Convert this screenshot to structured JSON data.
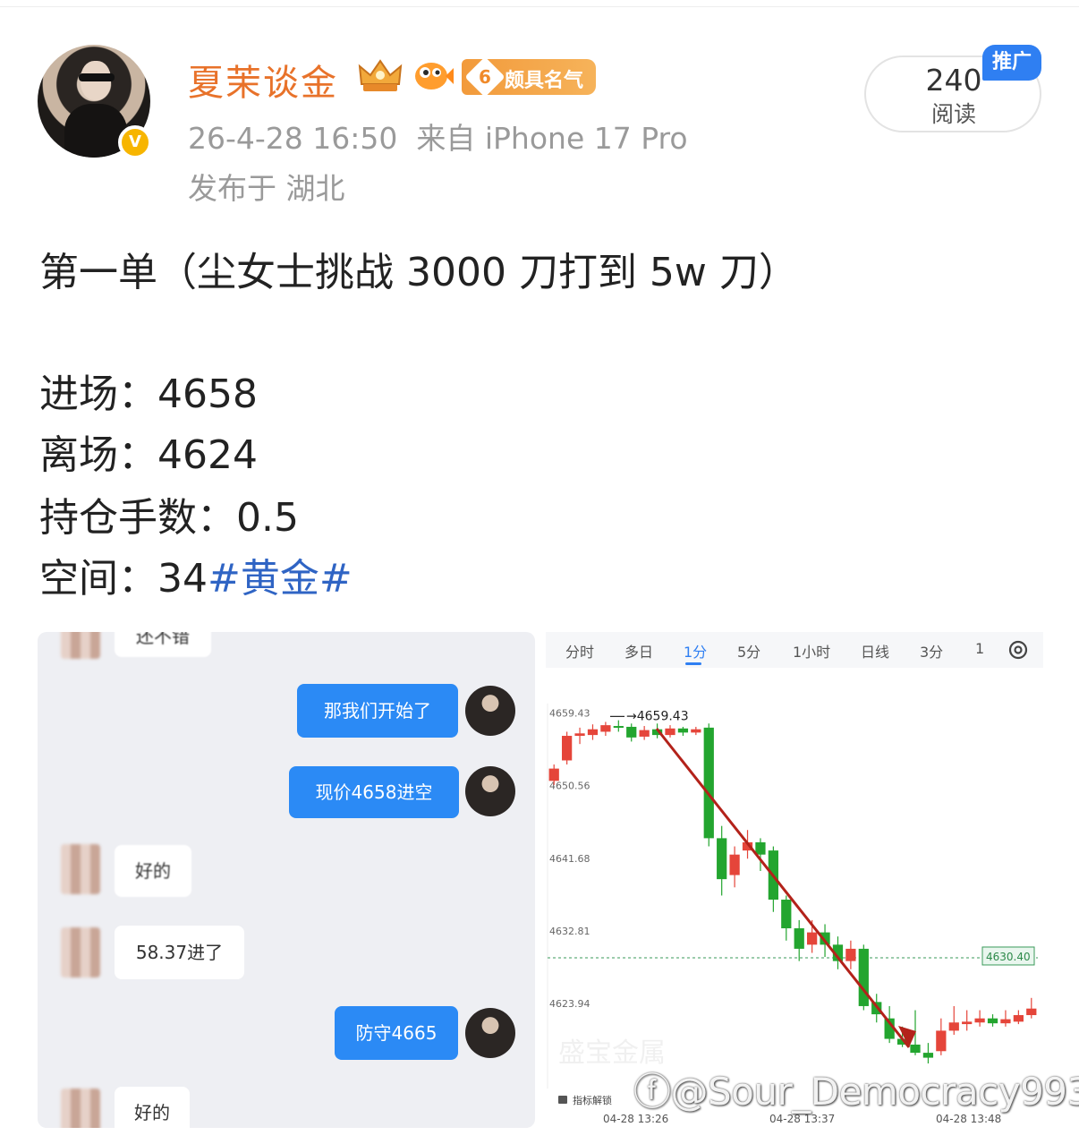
{
  "post": {
    "author": {
      "name": "夏茉谈金",
      "badge_level": "6",
      "badge_label": "颇具名气",
      "verified_mark": "V"
    },
    "meta": "26-4-28 16:50  来自 iPhone 17 Pro",
    "location": "发布于 湖北",
    "reads": {
      "count": "240",
      "label": "阅读"
    },
    "promo_tag": "推广",
    "lines": {
      "title": "第一单（尘女士挑战 3000 刀打到 5w 刀）",
      "entry": "进场：4658",
      "exit": "离场：4624",
      "lots": "持仓手数：0.5",
      "space_prefix": "空间：34",
      "hashtag": "#黄金#"
    }
  },
  "chat": {
    "messages": [
      {
        "side": "in",
        "text": "还不错"
      },
      {
        "side": "out",
        "text": "那我们开始了"
      },
      {
        "side": "out",
        "text": "现价4658进空"
      },
      {
        "side": "in",
        "text": "好的"
      },
      {
        "side": "in",
        "text": "58.37进了"
      },
      {
        "side": "out",
        "text": "防守4665"
      },
      {
        "side": "in",
        "text": "好的"
      }
    ]
  },
  "chart": {
    "tabs": [
      "分时",
      "多日",
      "1分",
      "5分",
      "1小时",
      "日线",
      "3分",
      "1"
    ],
    "active_tab": "1分",
    "high_label": "4659.43",
    "current_label": "4630.40",
    "low_label": "4623.94",
    "indicator_lock": "指标解锁",
    "watermark_brand": "盛宝金属",
    "icons": {
      "settings": "settings-icon",
      "lock": "lock-icon",
      "reset": "reset-icon"
    }
  },
  "chart_data": {
    "type": "candlestick",
    "ylim": [
      4623.94,
      4659.43
    ],
    "y_ticks": [
      "4659.43",
      "4650.56",
      "4641.68",
      "4632.81",
      "4623.94"
    ],
    "x_ticks": [
      "04-28 13:26",
      "04-28 13:37",
      "04-28 13:48"
    ],
    "reference_line": 4630.4,
    "annotation_high": "4659.43",
    "candles": [
      {
        "o": 4652.0,
        "c": 4653.5,
        "h": 4654.0,
        "l": 4651.5
      },
      {
        "o": 4654.5,
        "c": 4657.5,
        "h": 4658.0,
        "l": 4654.0
      },
      {
        "o": 4657.5,
        "c": 4657.8,
        "h": 4658.5,
        "l": 4656.5
      },
      {
        "o": 4657.6,
        "c": 4658.3,
        "h": 4658.9,
        "l": 4657.0
      },
      {
        "o": 4658.0,
        "c": 4658.8,
        "h": 4659.2,
        "l": 4657.5
      },
      {
        "o": 4658.7,
        "c": 4658.5,
        "h": 4659.4,
        "l": 4658.0
      },
      {
        "o": 4658.6,
        "c": 4657.3,
        "h": 4659.0,
        "l": 4656.8
      },
      {
        "o": 4657.4,
        "c": 4658.2,
        "h": 4658.7,
        "l": 4657.0
      },
      {
        "o": 4658.3,
        "c": 4657.6,
        "h": 4659.0,
        "l": 4657.2
      },
      {
        "o": 4657.6,
        "c": 4658.4,
        "h": 4658.8,
        "l": 4657.3
      },
      {
        "o": 4658.4,
        "c": 4657.9,
        "h": 4658.6,
        "l": 4657.5
      },
      {
        "o": 4657.9,
        "c": 4658.3,
        "h": 4658.6,
        "l": 4657.6
      },
      {
        "o": 4658.5,
        "c": 4645.0,
        "h": 4659.0,
        "l": 4644.0
      },
      {
        "o": 4645.0,
        "c": 4640.0,
        "h": 4646.5,
        "l": 4638.0
      },
      {
        "o": 4640.5,
        "c": 4643.0,
        "h": 4644.0,
        "l": 4639.0
      },
      {
        "o": 4643.5,
        "c": 4644.5,
        "h": 4646.0,
        "l": 4642.5
      },
      {
        "o": 4644.5,
        "c": 4643.0,
        "h": 4645.0,
        "l": 4641.0
      },
      {
        "o": 4643.5,
        "c": 4637.5,
        "h": 4644.0,
        "l": 4636.0
      },
      {
        "o": 4637.5,
        "c": 4634.0,
        "h": 4638.0,
        "l": 4632.5
      },
      {
        "o": 4634.0,
        "c": 4631.5,
        "h": 4635.0,
        "l": 4630.0
      },
      {
        "o": 4632.0,
        "c": 4633.5,
        "h": 4635.0,
        "l": 4631.0
      },
      {
        "o": 4633.5,
        "c": 4632.0,
        "h": 4634.5,
        "l": 4630.5
      },
      {
        "o": 4632.0,
        "c": 4630.0,
        "h": 4633.0,
        "l": 4629.0
      },
      {
        "o": 4630.0,
        "c": 4631.5,
        "h": 4632.5,
        "l": 4629.0
      },
      {
        "o": 4631.5,
        "c": 4624.5,
        "h": 4632.0,
        "l": 4624.0
      },
      {
        "o": 4625.0,
        "c": 4623.5,
        "h": 4626.0,
        "l": 4622.5
      },
      {
        "o": 4623.0,
        "c": 4620.5,
        "h": 4624.5,
        "l": 4620.0
      },
      {
        "o": 4620.5,
        "c": 4619.8,
        "h": 4622.0,
        "l": 4619.5
      },
      {
        "o": 4619.8,
        "c": 4618.8,
        "h": 4624.0,
        "l": 4618.5
      },
      {
        "o": 4618.8,
        "c": 4618.2,
        "h": 4620.0,
        "l": 4617.5
      },
      {
        "o": 4619.0,
        "c": 4621.5,
        "h": 4623.0,
        "l": 4618.5
      },
      {
        "o": 4621.5,
        "c": 4622.5,
        "h": 4624.5,
        "l": 4621.0
      },
      {
        "o": 4622.3,
        "c": 4622.6,
        "h": 4624.0,
        "l": 4621.5
      },
      {
        "o": 4622.5,
        "c": 4623.0,
        "h": 4624.0,
        "l": 4622.0
      },
      {
        "o": 4623.0,
        "c": 4622.4,
        "h": 4623.5,
        "l": 4622.0
      },
      {
        "o": 4622.4,
        "c": 4622.9,
        "h": 4624.0,
        "l": 4622.0
      },
      {
        "o": 4622.6,
        "c": 4623.4,
        "h": 4624.0,
        "l": 4622.3
      },
      {
        "o": 4623.4,
        "c": 4624.2,
        "h": 4625.5,
        "l": 4623.0
      }
    ]
  }
}
